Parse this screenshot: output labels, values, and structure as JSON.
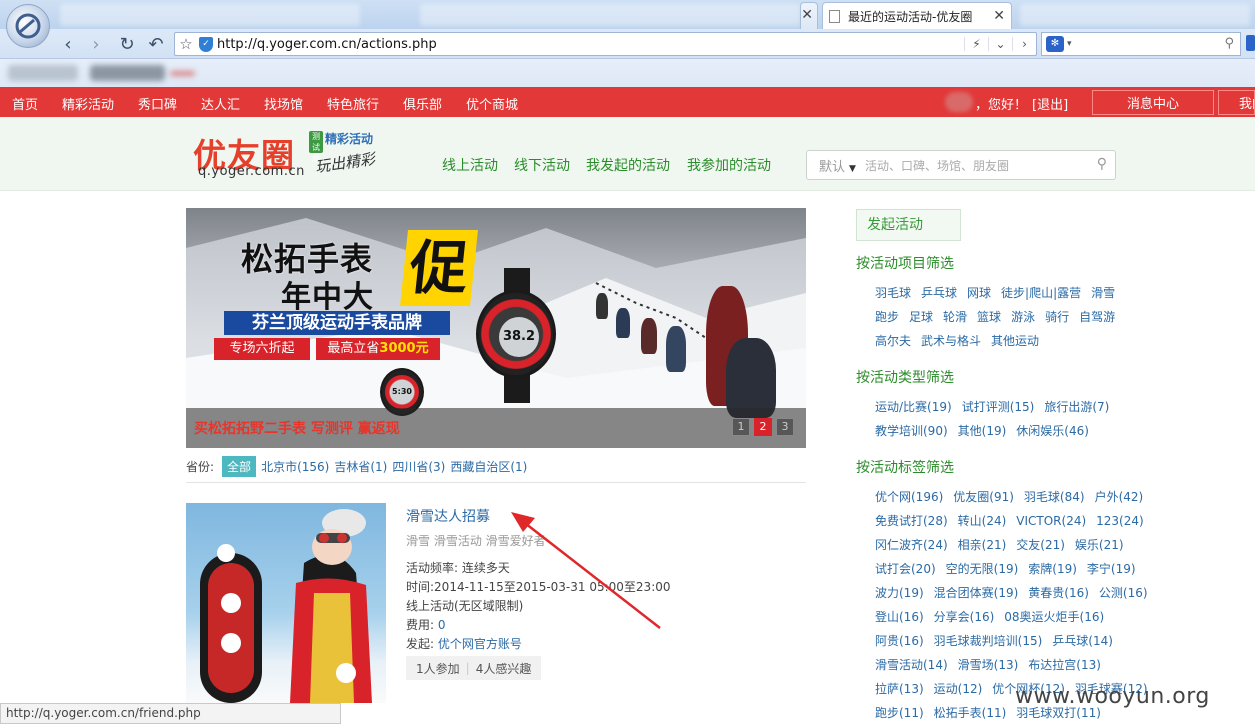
{
  "browser": {
    "active_tab_title": "最近的运动活动-优友圈",
    "url": "http://q.yoger.com.cn/actions.php",
    "status_url": "http://q.yoger.com.cn/friend.php",
    "close_glyph": "✕"
  },
  "site_nav": {
    "items": [
      "首页",
      "精彩活动",
      "秀口碑",
      "达人汇",
      "找场馆",
      "特色旅行",
      "俱乐部",
      "优个商城"
    ],
    "greeting": "，您好！",
    "logout": "[退出]",
    "message_center": "消息中心",
    "my_cut": "我的"
  },
  "header": {
    "logo_text": "优友圈",
    "logo_version": "测试版",
    "logo_tagline": "精彩活动",
    "logo_domain": "q.yoger.com.cn",
    "logo_script": "玩出精彩",
    "nav": [
      "线上活动",
      "线下活动",
      "我发起的活动",
      "我参加的活动"
    ],
    "search_scope": "默认",
    "search_placeholder": "活动、口碑、场馆、朋友圈"
  },
  "banner": {
    "title_line1": "松拓手表",
    "title_line2": "年中大",
    "title_big": "促",
    "subtitle": "芬兰顶级运动手表品牌",
    "sale1": "专场六折起",
    "sale2_prefix": "最高立省",
    "sale2_amount": "3000元",
    "watch_big_reading": "38.2",
    "watch_small_reading": "5:30",
    "caption": "买松拓拓野二手表 写测评 赢返现",
    "slides": [
      "1",
      "2",
      "3"
    ],
    "active_slide": 2
  },
  "province_filter": {
    "label": "省份:",
    "items": [
      "全部",
      "北京市(156)",
      "吉林省(1)",
      "四川省(3)",
      "西藏自治区(1)"
    ]
  },
  "activity": {
    "title": "滑雪达人招募",
    "tags": "滑雪  滑雪活动  滑雪爱好者",
    "freq_label": "活动频率:",
    "freq_value": "连续多天",
    "time_label": "时间:",
    "time_value": "2014-11-15至2015-03-31 05:00至23:00",
    "mode": "线上活动(无区域限制)",
    "fee_label": "费用:",
    "fee_value": "0",
    "host_label": "发起:",
    "host_value": "优个网官方账号",
    "joined": "1人参加",
    "interested": "4人感兴趣"
  },
  "sidebar": {
    "create_label": "发起活动",
    "sections": [
      {
        "heading": "按活动项目筛选",
        "rows": [
          [
            "羽毛球",
            "乒乓球",
            "网球",
            "徒步|爬山|露营",
            "滑雪"
          ],
          [
            "跑步",
            "足球",
            "轮滑",
            "篮球",
            "游泳",
            "骑行",
            "自驾游"
          ],
          [
            "高尔夫",
            "武术与格斗",
            "其他运动"
          ]
        ]
      },
      {
        "heading": "按活动类型筛选",
        "rows": [
          [
            "运动/比赛(19)",
            "试打评测(15)",
            "旅行出游(7)"
          ],
          [
            "教学培训(90)",
            "其他(19)",
            "休闲娱乐(46)"
          ]
        ]
      },
      {
        "heading": "按活动标签筛选",
        "rows": [
          [
            "优个网(196)",
            "优友圈(91)",
            "羽毛球(84)",
            "户外(42)"
          ],
          [
            "免费试打(28)",
            "转山(24)",
            "VICTOR(24)",
            "123(24)"
          ],
          [
            "冈仁波齐(24)",
            "相亲(21)",
            "交友(21)",
            "娱乐(21)"
          ],
          [
            "试打会(20)",
            "空的无限(19)",
            "索牌(19)",
            "李宁(19)"
          ],
          [
            "波力(19)",
            "混合团体赛(19)",
            "黄春贵(16)",
            "公测(16)"
          ],
          [
            "登山(16)",
            "分享会(16)",
            "08奥运火炬手(16)"
          ],
          [
            "阿贵(16)",
            "羽毛球裁判培训(15)",
            "乒乓球(14)"
          ],
          [
            "滑雪活动(14)",
            "滑雪场(13)",
            "布达拉宫(13)"
          ],
          [
            "拉萨(13)",
            "运动(12)",
            "优个网杯(12)",
            "羽毛球赛(12)"
          ],
          [
            "跑步(11)",
            "松拓手表(11)",
            "羽毛球双打(11)"
          ]
        ]
      }
    ]
  },
  "watermark": "www.wooyun.org",
  "colors": {
    "site_red": "#e23838",
    "link_blue": "#2b6aa5",
    "green": "#2a8c2a",
    "filter_active": "#4db8c0"
  }
}
